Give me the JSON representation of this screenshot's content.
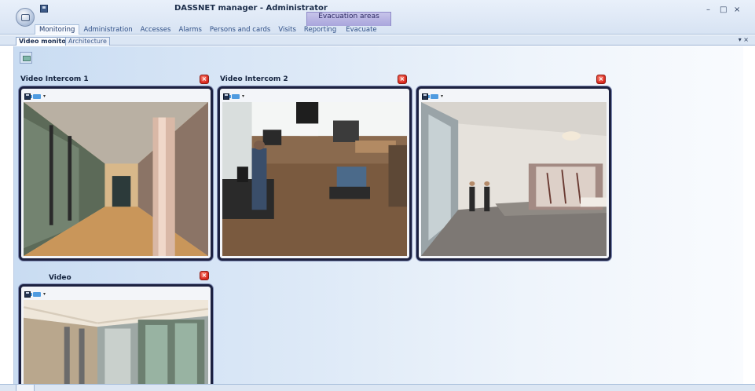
{
  "window": {
    "title": "DASSNET manager - Administrator",
    "context_tab": "Evacuation areas",
    "controls": [
      "–",
      "□",
      "×"
    ]
  },
  "menu": {
    "items": [
      {
        "label": "Monitoring",
        "active": true
      },
      {
        "label": "Administration"
      },
      {
        "label": "Accesses"
      },
      {
        "label": "Alarms"
      },
      {
        "label": "Persons and cards"
      },
      {
        "label": "Visits"
      },
      {
        "label": "Reporting"
      },
      {
        "label": "Evacuate"
      }
    ]
  },
  "doc_tabs": {
    "active": "Video monitor",
    "inactive": "Architecture",
    "controls": "▾ ×"
  },
  "cameras": [
    {
      "title": "Video Intercom 1",
      "close": "×"
    },
    {
      "title": "Video Intercom 2",
      "close": "×"
    },
    {
      "title": "",
      "close": "×"
    },
    {
      "title": "Video",
      "close": "×"
    }
  ],
  "icons": {
    "app_menu": "app-orb-icon",
    "quick_access": "save-icon",
    "layout_tool": "layout-icon",
    "camera_save": "save-icon",
    "camera_source": "camera-icon",
    "close": "close-icon"
  },
  "colors": {
    "accent": "#2f4f86",
    "context_tab": "#b9b6e4",
    "frame_border": "#1c2140",
    "close_red": "#d8261c"
  }
}
